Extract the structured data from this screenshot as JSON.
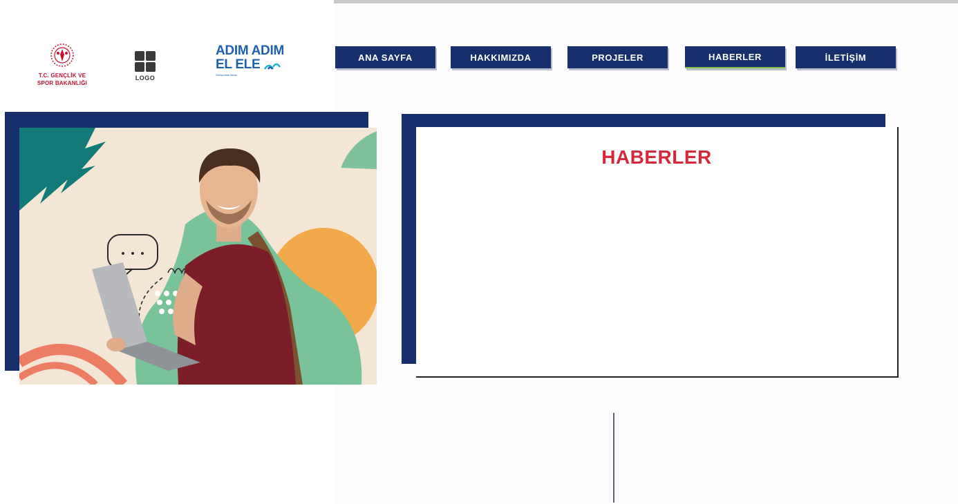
{
  "logos": {
    "ministry": {
      "line1": "T.C. GENÇLİK VE",
      "line2": "SPOR BAKANLIĞI",
      "icon": "ministry-emblem-icon"
    },
    "generic": {
      "text": "LOGO",
      "icon": "grid-logo-icon"
    },
    "campaign": {
      "line1": "ADIM ADIM",
      "line2": "EL ELE",
      "tagline": "Gelişmekte Miras",
      "icon": "signal-waves-icon"
    }
  },
  "nav": {
    "items": [
      {
        "label": "ANA SAYFA"
      },
      {
        "label": "HAKKIMIZDA"
      },
      {
        "label": "PROJELER"
      },
      {
        "label": "HABERLER"
      },
      {
        "label": "İLETİŞİM"
      }
    ],
    "active_index": 3
  },
  "hero": {
    "icon": "student-with-laptop-illustration"
  },
  "news": {
    "title": "HABERLER"
  },
  "colors": {
    "navy": "#17306d",
    "accent_red": "#d4283c",
    "ministry_red": "#c8102e",
    "campaign_blue": "#1f5fae",
    "active_underline": "#7dc142"
  }
}
